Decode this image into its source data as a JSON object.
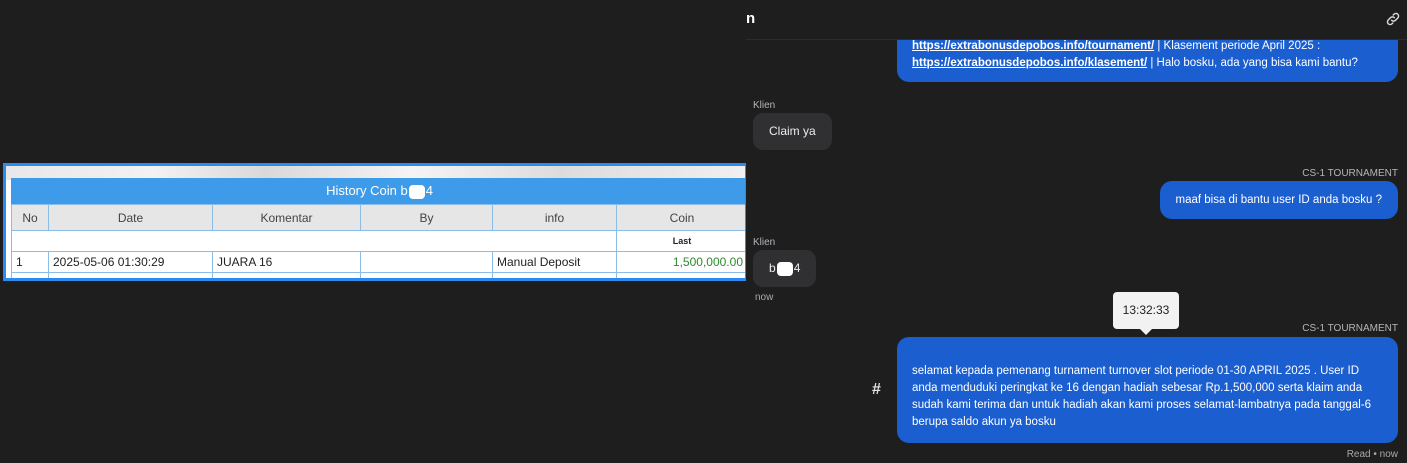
{
  "history": {
    "title_prefix": "History Coin b",
    "title_suffix": "4",
    "headers": [
      "No",
      "Date",
      "Komentar",
      "By",
      "info",
      "Coin"
    ],
    "sub_label": "Last",
    "rows": [
      {
        "no": "1",
        "date": "2025-05-06 01:30:29",
        "komentar": "JUARA 16",
        "by": "",
        "info": "Manual Deposit",
        "coin": "1,500,000.00"
      }
    ]
  },
  "chat": {
    "title": "n",
    "msg1_link1": "https://extrabonusdepobos.info/tournament/",
    "msg1_text1": " | Klasement periode April 2025 : ",
    "msg1_link2": "https://extrabonusdepobos.info/klasement/",
    "msg1_text2": " | Halo bosku, ada yang bisa kami bantu?",
    "sender_client": "Klien",
    "msg2": "Claim ya",
    "sender_cs": "CS-1 TOURNAMENT",
    "msg3": "maaf bisa di bantu user ID anda bosku ?",
    "sender_client2": "Klien",
    "msg4_prefix": "b",
    "msg4_suffix": "4",
    "msg4_time": "now",
    "tooltip_time": "13:32:33",
    "sender_cs2": "CS-1 TOURNAMENT",
    "msg5": "selamat kepada pemenang turnament turnover slot periode 01-30 APRIL 2025 . User ID anda menduduki peringkat ke 16 dengan hadiah sebesar Rp.1,500,000 serta klaim anda sudah kami terima dan untuk hadiah akan kami proses selamat-lambatnya pada tanggal-6 berupa saldo akun ya bosku",
    "hash": "#",
    "read_status": "Read • now"
  },
  "colors": {
    "accent": "#1a5ecf",
    "table_header": "#3d9be9",
    "coin_value": "#2d8a2d"
  }
}
